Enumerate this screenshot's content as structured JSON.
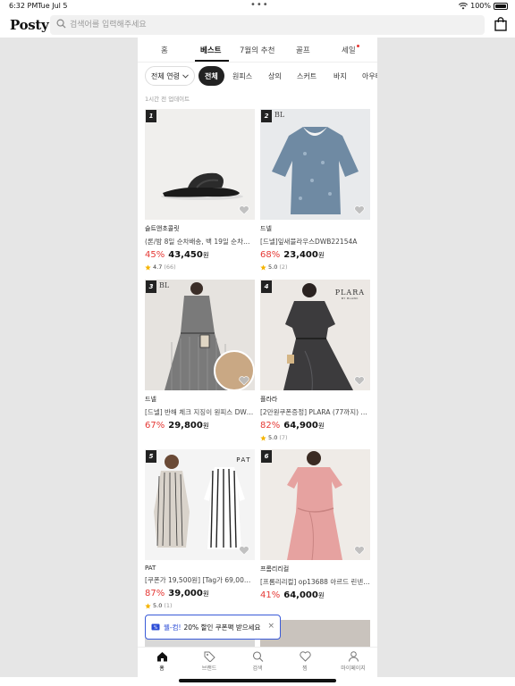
{
  "status_bar": {
    "time": "6:32 PM",
    "date": "Tue Jul 5",
    "battery": "100%"
  },
  "header": {
    "logo": "Posty",
    "search_placeholder": "검색어를 입력해주세요"
  },
  "tabs": [
    {
      "label": "홈"
    },
    {
      "label": "베스트"
    },
    {
      "label": "7월의 추천"
    },
    {
      "label": "골프"
    },
    {
      "label": "세일"
    }
  ],
  "filters": {
    "age_dropdown": "전체 연령",
    "chips": [
      "전체",
      "원피스",
      "상의",
      "스커트",
      "바지",
      "아우터"
    ]
  },
  "updated_text": "1시간 전 업데이트",
  "products": [
    {
      "rank": "1",
      "brand": "슬트앤초콜릿",
      "title": "(론/밤 8일 순차배송, 백 19일 순차배송)",
      "discount": "45%",
      "price": "43,450",
      "won": "원",
      "rating": "4.7",
      "reviews": "(66)"
    },
    {
      "rank": "2",
      "brand": "드넬",
      "title": "[드넬]잎새블라우스DWB22154A",
      "discount": "68%",
      "price": "23,400",
      "won": "원",
      "rating": "5.0",
      "reviews": "(2)"
    },
    {
      "rank": "3",
      "brand": "드넬",
      "title": "[드넬] 반해 체크 지징이 원피스 DWO22",
      "discount": "67%",
      "price": "29,800",
      "won": "원",
      "rating": "",
      "reviews": ""
    },
    {
      "rank": "4",
      "brand": "플라라",
      "title": "[2만원쿠폰증정] PLARA (77까지) 셔츠",
      "discount": "82%",
      "price": "64,900",
      "won": "원",
      "rating": "5.0",
      "reviews": "(7)"
    },
    {
      "rank": "5",
      "brand": "PAT",
      "title": "[쿠폰가 19,500원] [Tag가 69,000원]",
      "discount": "87%",
      "price": "39,000",
      "won": "원",
      "rating": "5.0",
      "reviews": "(1)"
    },
    {
      "rank": "6",
      "brand": "프롬리리컬",
      "title": "[프롬리리컬] op13688 아르드 린넨 원피스",
      "discount": "41%",
      "price": "64,000",
      "won": "원",
      "rating": "",
      "reviews": ""
    }
  ],
  "image_labels": {
    "plara_logo": "PLARA",
    "plara_sub": "BY BLANC",
    "pat_logo": "PAT",
    "bl_logo": "BL"
  },
  "banner": {
    "prefix": "웰-컴!",
    "text": "20% 할인 쿠폰팩 받으세요"
  },
  "tabbar": [
    {
      "label": "홈",
      "icon": "home-icon"
    },
    {
      "label": "브랜드",
      "icon": "tag-icon"
    },
    {
      "label": "검색",
      "icon": "search-icon"
    },
    {
      "label": "찜",
      "icon": "heart-icon"
    },
    {
      "label": "마이페이지",
      "icon": "person-icon"
    }
  ],
  "colors": {
    "accent_red": "#e53935",
    "banner_blue": "#2a4bd6",
    "star": "#f5b400"
  }
}
